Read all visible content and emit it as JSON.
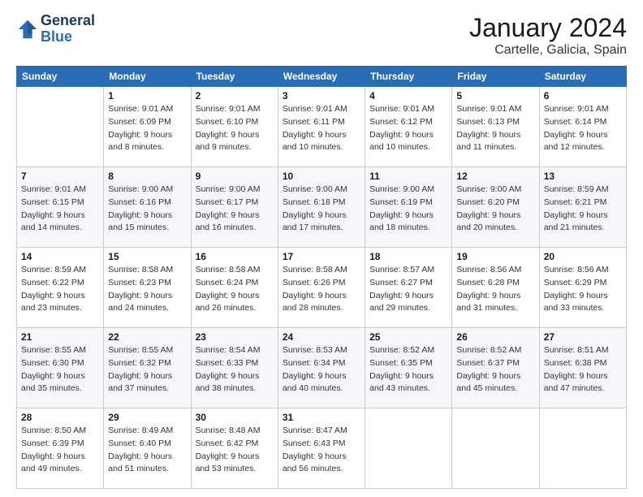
{
  "logo": {
    "line1": "General",
    "line2": "Blue"
  },
  "title": "January 2024",
  "subtitle": "Cartelle, Galicia, Spain",
  "weekdays": [
    "Sunday",
    "Monday",
    "Tuesday",
    "Wednesday",
    "Thursday",
    "Friday",
    "Saturday"
  ],
  "weeks": [
    [
      {
        "day": "",
        "sunrise": "",
        "sunset": "",
        "daylight": ""
      },
      {
        "day": "1",
        "sunrise": "Sunrise: 9:01 AM",
        "sunset": "Sunset: 6:09 PM",
        "daylight": "Daylight: 9 hours and 8 minutes."
      },
      {
        "day": "2",
        "sunrise": "Sunrise: 9:01 AM",
        "sunset": "Sunset: 6:10 PM",
        "daylight": "Daylight: 9 hours and 9 minutes."
      },
      {
        "day": "3",
        "sunrise": "Sunrise: 9:01 AM",
        "sunset": "Sunset: 6:11 PM",
        "daylight": "Daylight: 9 hours and 10 minutes."
      },
      {
        "day": "4",
        "sunrise": "Sunrise: 9:01 AM",
        "sunset": "Sunset: 6:12 PM",
        "daylight": "Daylight: 9 hours and 10 minutes."
      },
      {
        "day": "5",
        "sunrise": "Sunrise: 9:01 AM",
        "sunset": "Sunset: 6:13 PM",
        "daylight": "Daylight: 9 hours and 11 minutes."
      },
      {
        "day": "6",
        "sunrise": "Sunrise: 9:01 AM",
        "sunset": "Sunset: 6:14 PM",
        "daylight": "Daylight: 9 hours and 12 minutes."
      }
    ],
    [
      {
        "day": "7",
        "sunrise": "Sunrise: 9:01 AM",
        "sunset": "Sunset: 6:15 PM",
        "daylight": "Daylight: 9 hours and 14 minutes."
      },
      {
        "day": "8",
        "sunrise": "Sunrise: 9:00 AM",
        "sunset": "Sunset: 6:16 PM",
        "daylight": "Daylight: 9 hours and 15 minutes."
      },
      {
        "day": "9",
        "sunrise": "Sunrise: 9:00 AM",
        "sunset": "Sunset: 6:17 PM",
        "daylight": "Daylight: 9 hours and 16 minutes."
      },
      {
        "day": "10",
        "sunrise": "Sunrise: 9:00 AM",
        "sunset": "Sunset: 6:18 PM",
        "daylight": "Daylight: 9 hours and 17 minutes."
      },
      {
        "day": "11",
        "sunrise": "Sunrise: 9:00 AM",
        "sunset": "Sunset: 6:19 PM",
        "daylight": "Daylight: 9 hours and 18 minutes."
      },
      {
        "day": "12",
        "sunrise": "Sunrise: 9:00 AM",
        "sunset": "Sunset: 6:20 PM",
        "daylight": "Daylight: 9 hours and 20 minutes."
      },
      {
        "day": "13",
        "sunrise": "Sunrise: 8:59 AM",
        "sunset": "Sunset: 6:21 PM",
        "daylight": "Daylight: 9 hours and 21 minutes."
      }
    ],
    [
      {
        "day": "14",
        "sunrise": "Sunrise: 8:59 AM",
        "sunset": "Sunset: 6:22 PM",
        "daylight": "Daylight: 9 hours and 23 minutes."
      },
      {
        "day": "15",
        "sunrise": "Sunrise: 8:58 AM",
        "sunset": "Sunset: 6:23 PM",
        "daylight": "Daylight: 9 hours and 24 minutes."
      },
      {
        "day": "16",
        "sunrise": "Sunrise: 8:58 AM",
        "sunset": "Sunset: 6:24 PM",
        "daylight": "Daylight: 9 hours and 26 minutes."
      },
      {
        "day": "17",
        "sunrise": "Sunrise: 8:58 AM",
        "sunset": "Sunset: 6:26 PM",
        "daylight": "Daylight: 9 hours and 28 minutes."
      },
      {
        "day": "18",
        "sunrise": "Sunrise: 8:57 AM",
        "sunset": "Sunset: 6:27 PM",
        "daylight": "Daylight: 9 hours and 29 minutes."
      },
      {
        "day": "19",
        "sunrise": "Sunrise: 8:56 AM",
        "sunset": "Sunset: 6:28 PM",
        "daylight": "Daylight: 9 hours and 31 minutes."
      },
      {
        "day": "20",
        "sunrise": "Sunrise: 8:56 AM",
        "sunset": "Sunset: 6:29 PM",
        "daylight": "Daylight: 9 hours and 33 minutes."
      }
    ],
    [
      {
        "day": "21",
        "sunrise": "Sunrise: 8:55 AM",
        "sunset": "Sunset: 6:30 PM",
        "daylight": "Daylight: 9 hours and 35 minutes."
      },
      {
        "day": "22",
        "sunrise": "Sunrise: 8:55 AM",
        "sunset": "Sunset: 6:32 PM",
        "daylight": "Daylight: 9 hours and 37 minutes."
      },
      {
        "day": "23",
        "sunrise": "Sunrise: 8:54 AM",
        "sunset": "Sunset: 6:33 PM",
        "daylight": "Daylight: 9 hours and 38 minutes."
      },
      {
        "day": "24",
        "sunrise": "Sunrise: 8:53 AM",
        "sunset": "Sunset: 6:34 PM",
        "daylight": "Daylight: 9 hours and 40 minutes."
      },
      {
        "day": "25",
        "sunrise": "Sunrise: 8:52 AM",
        "sunset": "Sunset: 6:35 PM",
        "daylight": "Daylight: 9 hours and 43 minutes."
      },
      {
        "day": "26",
        "sunrise": "Sunrise: 8:52 AM",
        "sunset": "Sunset: 6:37 PM",
        "daylight": "Daylight: 9 hours and 45 minutes."
      },
      {
        "day": "27",
        "sunrise": "Sunrise: 8:51 AM",
        "sunset": "Sunset: 6:38 PM",
        "daylight": "Daylight: 9 hours and 47 minutes."
      }
    ],
    [
      {
        "day": "28",
        "sunrise": "Sunrise: 8:50 AM",
        "sunset": "Sunset: 6:39 PM",
        "daylight": "Daylight: 9 hours and 49 minutes."
      },
      {
        "day": "29",
        "sunrise": "Sunrise: 8:49 AM",
        "sunset": "Sunset: 6:40 PM",
        "daylight": "Daylight: 9 hours and 51 minutes."
      },
      {
        "day": "30",
        "sunrise": "Sunrise: 8:48 AM",
        "sunset": "Sunset: 6:42 PM",
        "daylight": "Daylight: 9 hours and 53 minutes."
      },
      {
        "day": "31",
        "sunrise": "Sunrise: 8:47 AM",
        "sunset": "Sunset: 6:43 PM",
        "daylight": "Daylight: 9 hours and 56 minutes."
      },
      {
        "day": "",
        "sunrise": "",
        "sunset": "",
        "daylight": ""
      },
      {
        "day": "",
        "sunrise": "",
        "sunset": "",
        "daylight": ""
      },
      {
        "day": "",
        "sunrise": "",
        "sunset": "",
        "daylight": ""
      }
    ]
  ]
}
